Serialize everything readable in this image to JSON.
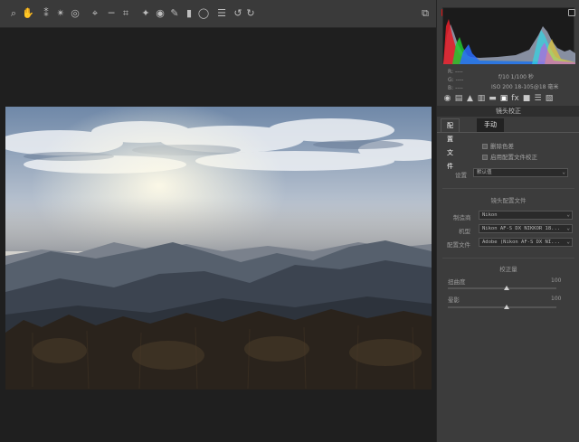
{
  "toolbar": {
    "tools": [
      {
        "icon": "zoom-icon",
        "glyph": "⌕"
      },
      {
        "icon": "hand-icon",
        "glyph": "✋"
      },
      {
        "icon": "white-balance-icon",
        "glyph": "⁑"
      },
      {
        "icon": "color-sampler-icon",
        "glyph": "✴"
      },
      {
        "icon": "targeted-adjustment-icon",
        "glyph": "◎"
      },
      {
        "icon": "crop-icon",
        "glyph": "⌖"
      },
      {
        "icon": "straighten-icon",
        "glyph": "─"
      },
      {
        "icon": "transform-icon",
        "glyph": "⌗"
      },
      {
        "icon": "spot-removal-icon",
        "glyph": "✦"
      },
      {
        "icon": "red-eye-icon",
        "glyph": "◉"
      },
      {
        "icon": "adjustment-brush-icon",
        "glyph": "✎"
      },
      {
        "icon": "graduated-filter-icon",
        "glyph": "▮"
      },
      {
        "icon": "radial-filter-icon",
        "glyph": "◯"
      },
      {
        "icon": "preferences-icon",
        "glyph": "☰"
      },
      {
        "icon": "rotate-ccw-icon",
        "glyph": "↺"
      },
      {
        "icon": "rotate-cw-icon",
        "glyph": "↻"
      }
    ],
    "fullscreen_icon": "fullscreen-icon",
    "fullscreen_glyph": "⧉"
  },
  "photo": {
    "subject": "landscape"
  },
  "info": {
    "r_label": "R:",
    "g_label": "G:",
    "b_label": "B:",
    "r_value": "----",
    "g_value": "----",
    "b_value": "----",
    "exposure": "f/10   1/100 秒",
    "iso_lens": "ISO 200   18-105@18 毫米"
  },
  "panel_tabs": [
    {
      "icon": "basic-icon",
      "glyph": "◉"
    },
    {
      "icon": "tone-curve-icon",
      "glyph": "▤"
    },
    {
      "icon": "detail-icon",
      "glyph": "▲"
    },
    {
      "icon": "hsl-icon",
      "glyph": "▥"
    },
    {
      "icon": "split-toning-icon",
      "glyph": "▬"
    },
    {
      "icon": "lens-corrections-icon",
      "glyph": "▣",
      "active": true
    },
    {
      "icon": "effects-icon",
      "glyph": "fx"
    },
    {
      "icon": "camera-calibration-icon",
      "glyph": "■"
    },
    {
      "icon": "presets-icon",
      "glyph": "☰"
    },
    {
      "icon": "snapshots-icon",
      "glyph": "▧"
    }
  ],
  "panel": {
    "title": "镜头校正",
    "tab_profile": "配置文件",
    "tab_manual": "手动",
    "chk_remove_ca": "删除色差",
    "chk_enable_profile": "启用配置文件校正",
    "setup_label": "设置",
    "setup_value": "默认值",
    "section_profile": "镜头配置文件",
    "make_label": "制造商",
    "make_value": "Nikon",
    "model_label": "机型",
    "model_value": "Nikon AF-S DX NIKKOR 18...",
    "profile_label": "配置文件",
    "profile_value": "Adobe (Nikon AF-S DX NI...",
    "section_amount": "校正量",
    "distortion_label": "扭曲度",
    "distortion_value": "100",
    "vignetting_label": "晕影",
    "vignetting_value": "100"
  },
  "sliders": {
    "distortion": 1.0,
    "vignetting": 1.0
  },
  "colors": {
    "panel_bg": "#3c3c3c",
    "toolbar_bg": "#3a3a3a",
    "canvas_bg": "#1f1f1f",
    "shadow_clip": "#dd1111"
  }
}
